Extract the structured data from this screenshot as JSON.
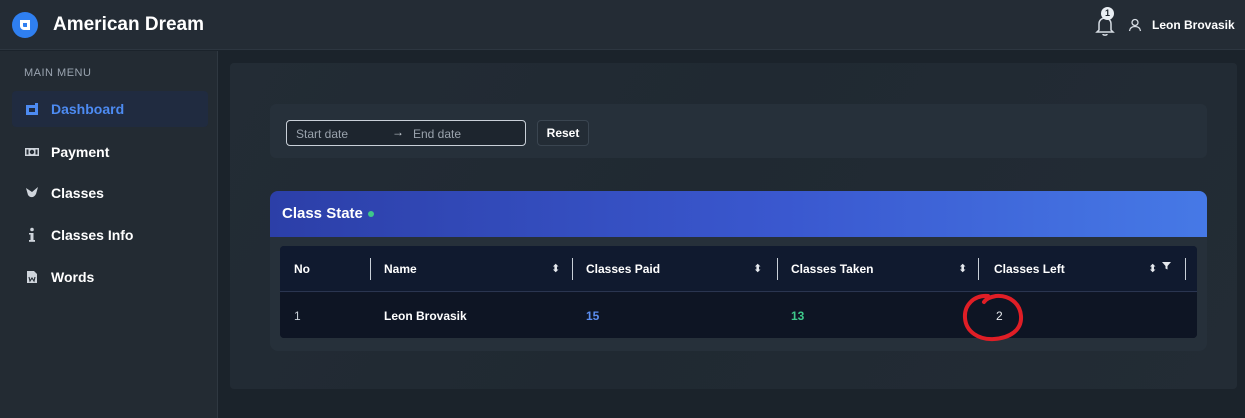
{
  "app": {
    "title": "American Dream"
  },
  "header": {
    "notification_count": "1",
    "user_name": "Leon Brovasik"
  },
  "sidebar": {
    "heading": "MAIN MENU",
    "items": [
      {
        "label": "Dashboard",
        "icon": "dashboard-icon",
        "active": true
      },
      {
        "label": "Payment",
        "icon": "payment-icon",
        "active": false
      },
      {
        "label": "Classes",
        "icon": "classes-icon",
        "active": false
      },
      {
        "label": "Classes Info",
        "icon": "info-icon",
        "active": false
      },
      {
        "label": "Words",
        "icon": "words-icon",
        "active": false
      }
    ]
  },
  "filter": {
    "start_placeholder": "Start date",
    "end_placeholder": "End date",
    "reset_label": "Reset"
  },
  "class_state": {
    "title": "Class State",
    "columns": [
      "No",
      "Name",
      "Classes Paid",
      "Classes Taken",
      "Classes Left"
    ],
    "rows": [
      {
        "no": "1",
        "name": "Leon Brovasik",
        "paid": "15",
        "taken": "13",
        "left": "2"
      }
    ]
  },
  "colors": {
    "accent": "#4d8bf2",
    "paid_value": "#5b8def",
    "taken_value": "#3ec88a",
    "annotation": "#e01e26"
  }
}
